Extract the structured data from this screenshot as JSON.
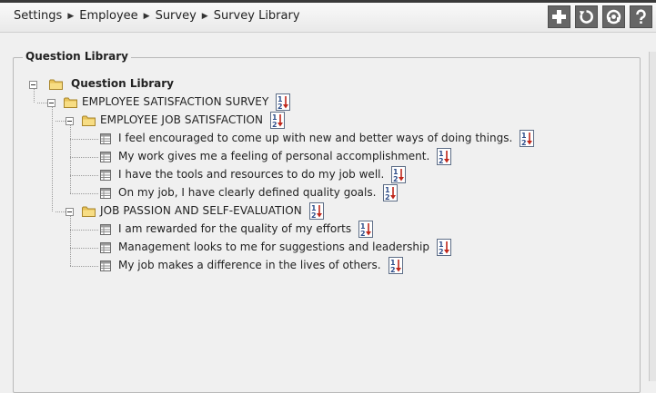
{
  "breadcrumb": [
    "Settings",
    "Employee",
    "Survey",
    "Survey Library"
  ],
  "toolbar": {
    "icons": [
      "add-icon",
      "refresh-icon",
      "support-icon",
      "help-icon"
    ]
  },
  "library": {
    "legend": "Question Library",
    "root": "Question Library",
    "survey": "EMPLOYEE SATISFACTION SURVEY",
    "groups": [
      {
        "label": "EMPLOYEE JOB SATISFACTION",
        "questions": [
          "I feel encouraged to come up with new and better ways of doing things.",
          "My work gives me a feeling of personal accomplishment.",
          "I have the tools and resources to do my job well.",
          "On my job, I have clearly defined quality goals."
        ]
      },
      {
        "label": "JOB PASSION AND SELF-EVALUATION",
        "questions": [
          "I am rewarded for the quality of my efforts",
          "Management looks to me for suggestions and leadership",
          "My job makes a difference in the lives of others."
        ]
      }
    ]
  },
  "colors": {
    "tool_bg": "#666666",
    "folder": "#e8c35a",
    "sort_red": "#c0271b",
    "sort_blue": "#2f4e8a"
  }
}
